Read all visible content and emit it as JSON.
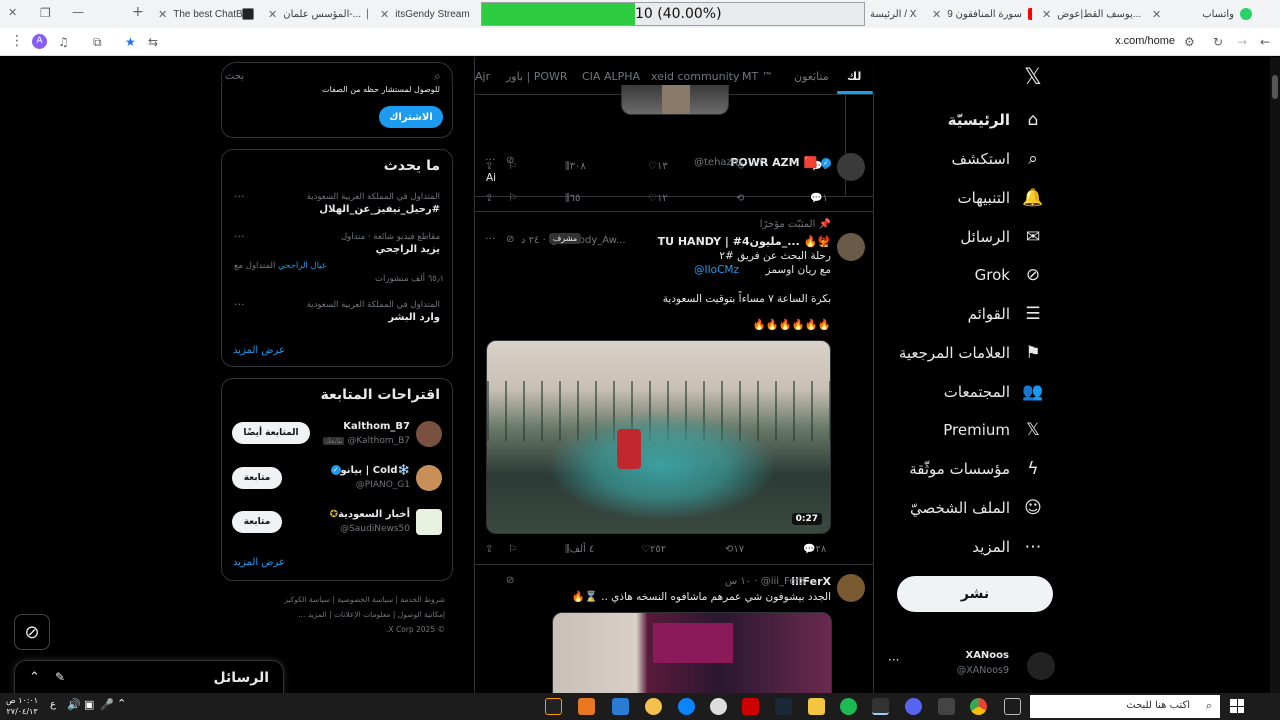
{
  "browser": {
    "tabs": [
      {
        "title": "واتساب",
        "color": "#25d366"
      },
      {
        "title": "يوسف القط|عوض...",
        "color": "#ff0000"
      },
      {
        "title": "سورة المنافقون 9",
        "color": "#ff0000"
      },
      {
        "title": "الرئيسة / X",
        "color": "#000000"
      },
      {
        "title": "itsGendy Stream",
        "color": "#53fc18"
      },
      {
        "title": "المؤسس علمان-...",
        "color": "#ff3366"
      },
      {
        "title": "The best ChatBot",
        "color": "#222222"
      }
    ],
    "progress": {
      "text": "10 (40.00%)",
      "fraction": 0.4
    },
    "url": "x.com/home",
    "profile_letter": "A"
  },
  "nav": {
    "items": [
      {
        "label": "الرئيسيّة",
        "icon": "home-icon",
        "glyph": "⌂"
      },
      {
        "label": "استكشف",
        "icon": "search-icon",
        "glyph": "⌕"
      },
      {
        "label": "التنبيهات",
        "icon": "bell-icon",
        "glyph": "🔔"
      },
      {
        "label": "الرسائل",
        "icon": "mail-icon",
        "glyph": "✉"
      },
      {
        "label": "Grok",
        "icon": "grok-icon",
        "glyph": "⊘"
      },
      {
        "label": "القوائم",
        "icon": "list-icon",
        "glyph": "☰"
      },
      {
        "label": "العلامات المرجعية",
        "icon": "bookmark-icon",
        "glyph": "⚑"
      },
      {
        "label": "المجتمعات",
        "icon": "communities-icon",
        "glyph": "👥"
      },
      {
        "label": "Premium",
        "icon": "x-logo-icon",
        "glyph": "𝕏"
      },
      {
        "label": "مؤسسات موثّقة",
        "icon": "lightning-icon",
        "glyph": "ϟ"
      },
      {
        "label": "الملف الشخصيّ",
        "icon": "profile-icon",
        "glyph": "☺"
      },
      {
        "label": "المزيد",
        "icon": "more-icon",
        "glyph": "⋯"
      }
    ],
    "post_label": "نشر",
    "account": {
      "name": "XANoos",
      "handle": "@XANoos9"
    }
  },
  "feed": {
    "tabs": [
      "لك",
      "متابَعون",
      "MT ™",
      "xeid community",
      "CIA ALPHA",
      "باور | POWR",
      "Ajr"
    ],
    "tweets": [
      {
        "actions": {
          "replies": "٤",
          "reposts": "",
          "likes": "١٣",
          "views": "٣٠٨"
        }
      },
      {
        "name": "POWR AZM",
        "handle": "@tehazm",
        "time": "٣٠ د",
        "text": "Ai",
        "actions": {
          "replies": "١",
          "reposts": "",
          "likes": "١٢",
          "views": "٦٥"
        }
      },
      {
        "pinned": "المثبّت مؤخرًا",
        "name": "TU HANDY | #4مليون_...",
        "handle": "@Hanody_Aw...",
        "badge": "مشرف",
        "time": "٢٤ د",
        "lines": [
          "رحلة البحث عن فريق #٢",
          "مع ريان اوسمز",
          "@IIoCMz",
          "بكرة الساعة ٧ مساءاً بتوقيت السعودية",
          "🔥🔥🔥🔥🔥🔥"
        ],
        "video_time": "0:27",
        "actions": {
          "replies": "٢٨",
          "reposts": "١٧",
          "likes": "٢٥٢",
          "views": "٤ ألف"
        }
      },
      {
        "name": "iiiFerX",
        "handle": "@iii_FerX",
        "time": "١٠ س",
        "text": "الجدد بيشوفون شي عمرهم ماشافوه النسخه هاذي .. ⌛🔥"
      }
    ]
  },
  "sidebar": {
    "search_placeholder": "بحث",
    "subscribe": {
      "cut_text": "للوصول لمستشار حظه من الصفات",
      "button": "الاشتراك"
    },
    "trends": {
      "title": "ما يحدث",
      "items": [
        {
          "meta": "المتداول في المملكة العربية السعودية",
          "title": "#رحيل_نيفيز_عن_الهلال"
        },
        {
          "meta": "مقاطع فيديو شائعة · متداول",
          "title": "يزيد الراجحي",
          "extra": "المتداول مع عيال الراجحي",
          "extra_link": "عيال الراجحي",
          "count": "٦٥٫١ ألف منشورات"
        },
        {
          "meta": "المتداول في المملكة العربية السعودية",
          "title": "وارد البشر"
        }
      ],
      "more": "عرض المزيد"
    },
    "suggestions": {
      "title": "اقتراحات المتابعة",
      "items": [
        {
          "name": "Kalthom_B7",
          "handle": "@Kalthom_B7",
          "follows_you": "يتابعك",
          "button": "المتابعة أيضًا"
        },
        {
          "name": "بيانو | Cold❄️",
          "handle": "@PIANO_G1",
          "button": "متابعة"
        },
        {
          "name": "أخبار السعودية",
          "handle": "@SaudiNews50",
          "button": "متابعة"
        }
      ],
      "more": "عرض المزيد"
    },
    "footer": [
      "شروط الخدمة",
      "سياسة الخصوصية",
      "سياسة الكوكيز",
      "إمكانية الوصول",
      "معلومات الإعلانات",
      "المزيد ...",
      "© 2025 X Corp."
    ]
  },
  "drawer": {
    "title": "الرسائل"
  },
  "taskbar": {
    "search_placeholder": "اكتب هنا للبحث",
    "time": "١٠:٠١ ص",
    "date": "٢٧/٠٤/١٣",
    "lang": "ع"
  }
}
